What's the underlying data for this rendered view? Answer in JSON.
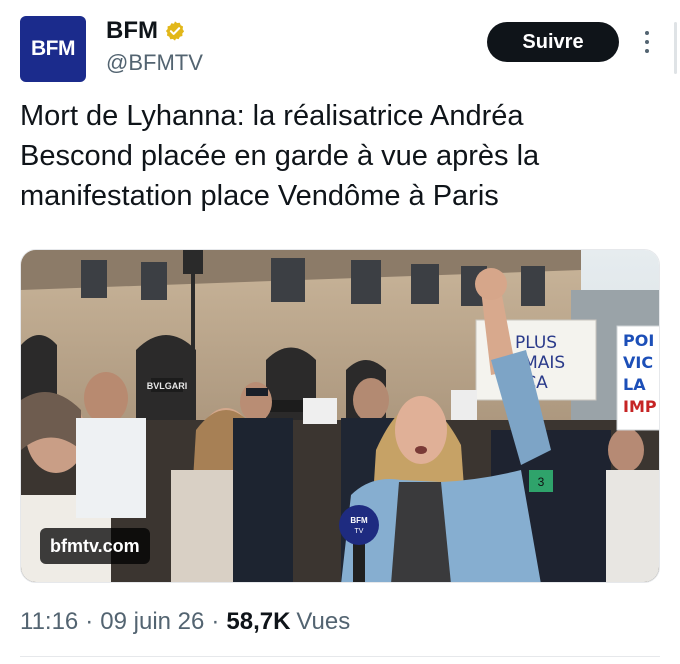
{
  "author": {
    "avatar_text": "BFM",
    "display_name": "BFM",
    "handle": "@BFMTV",
    "verified_badge": "gold-check-icon",
    "avatar_color": "#1b2b8c"
  },
  "actions": {
    "follow_label": "Suivre",
    "more_icon": "more-vertical-icon"
  },
  "tweet": {
    "text": "Mort de Lyhanna: la réalisatrice Andréa Bescond placée en garde à vue après la manifestation place Vendôme à Paris"
  },
  "media": {
    "watermark": "bfmtv.com",
    "sign_plus_jamais": "PLUS\nJAMAIS\nÇA",
    "sign_po_vic": "POI\nVIC\nLA\nIMP",
    "shop_sign": "BVLGARI",
    "mic_label": "BFM TV",
    "armband": "3"
  },
  "meta": {
    "time": "11:16",
    "date": "09 juin 26",
    "views_count": "58,7K",
    "views_label": "Vues"
  },
  "colors": {
    "brand": "#1b2b8c",
    "verified": "#e2b719",
    "button": "#0f1419",
    "secondary_text": "#536471"
  }
}
